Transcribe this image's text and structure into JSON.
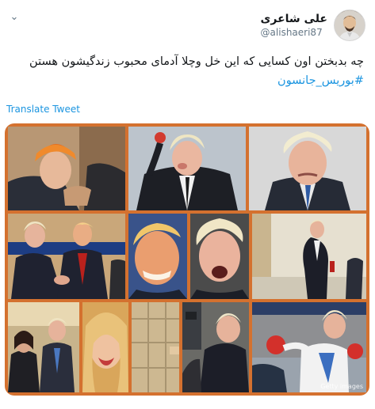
{
  "tweet": {
    "display_name": "علی شاعری",
    "handle": "@alishaeri87",
    "text_line1": "چه بدبختن اون کسایی که این خل وچلا آدمای محبوب زندگیشون هستن",
    "hashtag": "#بوریس_جانسون",
    "translate_label": "Translate Tweet",
    "more_icon": "chevron-down-icon"
  },
  "collage": {
    "border_color": "#d4712f",
    "watermark": "Getty images"
  }
}
